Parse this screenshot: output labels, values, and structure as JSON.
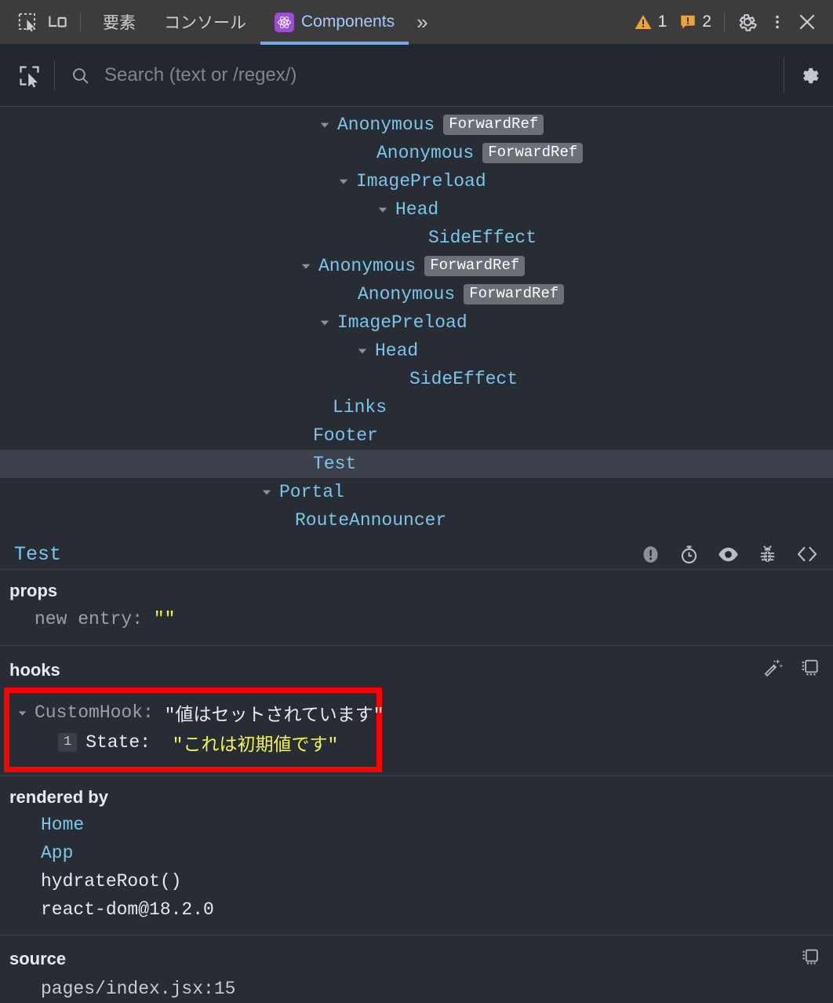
{
  "devtools_bar": {
    "inspect_icon": "inspect-element-icon",
    "device_icon": "device-toolbar-icon",
    "tabs": [
      {
        "label": "要素",
        "active": false
      },
      {
        "label": "コンソール",
        "active": false
      },
      {
        "label": "Components",
        "active": true,
        "icon": "react-logo-icon"
      }
    ],
    "more_tabs_label": "»",
    "warning_count": "1",
    "issue_count": "2",
    "settings_icon": "gear-icon",
    "kebab_icon": "more-options-icon",
    "close_icon": "close-icon"
  },
  "search": {
    "select_element_icon": "select-element-icon",
    "search_icon": "search-icon",
    "placeholder": "Search (text or /regex/)",
    "value": "",
    "settings_icon": "gear-icon"
  },
  "tree": {
    "rows": [
      {
        "label": "Anonymous",
        "badge": "ForwardRef",
        "indent": 11,
        "arrow": "down",
        "selected": false
      },
      {
        "label": "Anonymous",
        "badge": "ForwardRef",
        "indent": 12,
        "arrow": "none",
        "selected": false
      },
      {
        "label": "ImagePreload",
        "badge": "",
        "indent": 12,
        "arrow": "down",
        "selected": false
      },
      {
        "label": "Head",
        "badge": "",
        "indent": 13,
        "arrow": "down",
        "selected": false
      },
      {
        "label": "SideEffect",
        "badge": "",
        "indent": 14,
        "arrow": "none",
        "selected": false
      },
      {
        "label": "Anonymous",
        "badge": "ForwardRef",
        "indent": 10,
        "arrow": "down",
        "selected": false
      },
      {
        "label": "Anonymous",
        "badge": "ForwardRef",
        "indent": 11,
        "arrow": "none",
        "selected": false
      },
      {
        "label": "ImagePreload",
        "badge": "",
        "indent": 11,
        "arrow": "down",
        "selected": false
      },
      {
        "label": "Head",
        "badge": "",
        "indent": 12,
        "arrow": "down",
        "selected": false
      },
      {
        "label": "SideEffect",
        "badge": "",
        "indent": 13,
        "arrow": "none",
        "selected": false
      },
      {
        "label": "Links",
        "badge": "",
        "indent": 11,
        "arrow": "none",
        "selected": false
      },
      {
        "label": "Footer",
        "badge": "",
        "indent": 10,
        "arrow": "none",
        "selected": false
      },
      {
        "label": "Test",
        "badge": "",
        "indent": 10,
        "arrow": "none",
        "selected": true
      },
      {
        "label": "Portal",
        "badge": "",
        "indent": 8,
        "arrow": "down",
        "selected": false
      },
      {
        "label": "RouteAnnouncer",
        "badge": "",
        "indent": 9,
        "arrow": "none",
        "selected": false
      }
    ]
  },
  "details": {
    "selected_component": "Test",
    "header_icons": [
      "error-warning-icon",
      "suspense-timer-icon",
      "inspect-eye-icon",
      "debug-bug-icon",
      "view-source-code-icon"
    ],
    "props": {
      "title": "props",
      "entries": [
        {
          "key": "new entry",
          "value": "\"\""
        }
      ]
    },
    "hooks": {
      "title": "hooks",
      "tools": [
        "magic-wand-icon",
        "copy-to-clipboard-icon"
      ],
      "highlight_color": "#ff0000",
      "custom_hook": {
        "name": "CustomHook",
        "value": "\"値はセットされています\""
      },
      "state": {
        "index": "1",
        "name": "State",
        "value": "\"これは初期値です\""
      }
    },
    "rendered_by": {
      "title": "rendered by",
      "items": [
        {
          "label": "Home",
          "link": true
        },
        {
          "label": "App",
          "link": true
        },
        {
          "label": "hydrateRoot()",
          "link": false
        },
        {
          "label": "react-dom@18.2.0",
          "link": false
        }
      ]
    },
    "source": {
      "title": "source",
      "tools": [
        "copy-to-clipboard-icon"
      ],
      "path": "pages/index.jsx:15"
    }
  },
  "colors": {
    "accent_tab": "#7aa7ec",
    "react_purple": "#9a4fd1",
    "component_blue": "#7ac5e8",
    "value_yellow": "#f4f44a",
    "highlight_red": "#ff0000",
    "warning_orange": "#e8a33d",
    "panel_bg": "#282c34",
    "toolbar_bg": "#3c3c3c"
  }
}
